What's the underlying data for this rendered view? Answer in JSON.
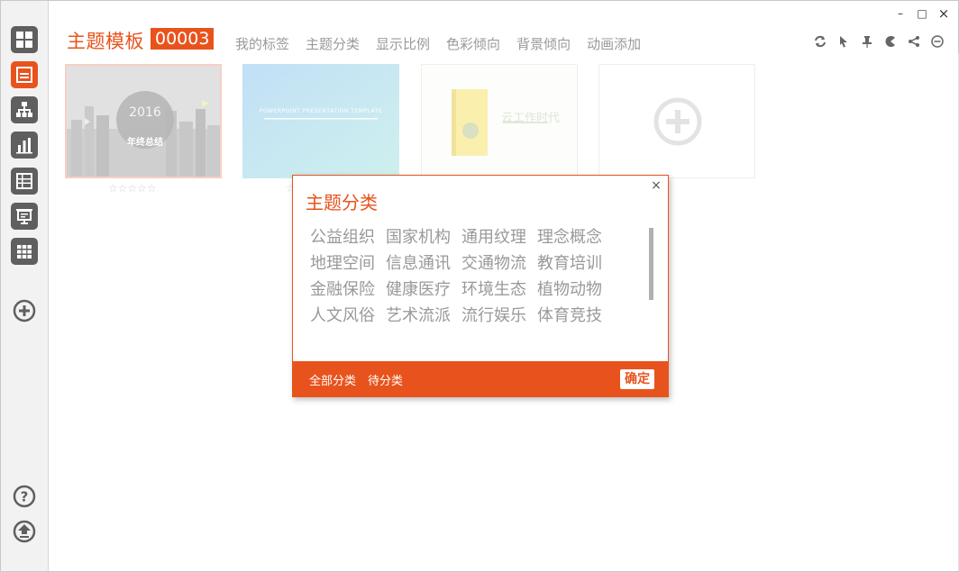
{
  "header": {
    "title": "主题模板",
    "badge": "00003",
    "menu": [
      "我的标签",
      "主题分类",
      "显示比例",
      "色彩倾向",
      "背景倾向",
      "动画添加"
    ]
  },
  "cards": [
    {
      "year": "2016",
      "subtitle": "年终总结"
    },
    {
      "banner": "POWERPOINT PRESENTATION TEMPLATE"
    },
    {
      "book_title": "云工作时代"
    },
    {
      "add": "⊕"
    }
  ],
  "stars": "☆☆☆☆☆",
  "modal": {
    "title": "主题分类",
    "categories": [
      "公益组织",
      "国家机构",
      "通用纹理",
      "理念概念",
      "地理空间",
      "信息通讯",
      "交通物流",
      "教育培训",
      "金融保险",
      "健康医疗",
      "环境生态",
      "植物动物",
      "人文风俗",
      "艺术流派",
      "流行娱乐",
      "体育竞技"
    ],
    "footer_all": "全部分类",
    "footer_pending": "待分类",
    "confirm": "确定",
    "close": "×"
  },
  "window": {
    "minimize": "–",
    "maximize": "□",
    "close": "×"
  },
  "colors": {
    "accent": "#e8531d",
    "sidebar_icon": "#5f5f5f"
  }
}
